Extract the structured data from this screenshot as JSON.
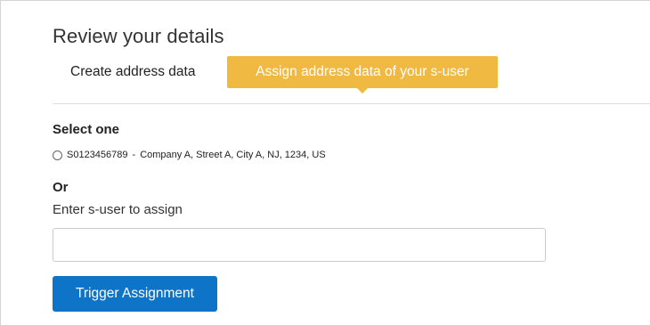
{
  "page": {
    "title": "Review your details"
  },
  "tabs": [
    {
      "label": "Create address data",
      "active": false
    },
    {
      "label": "Assign address data of your s-user",
      "active": true
    }
  ],
  "select_section": {
    "heading": "Select one",
    "options": [
      {
        "id": "S0123456789",
        "separator": "-",
        "address": "Company A, Street A, City A, NJ, 1234, US",
        "selected": false
      }
    ]
  },
  "or_section": {
    "heading": "Or",
    "input_label": "Enter s-user to assign",
    "input_value": "",
    "input_placeholder": ""
  },
  "actions": {
    "submit_label": "Trigger Assignment"
  },
  "colors": {
    "active_tab": "#efb942",
    "primary_button": "#0e74c7",
    "divider": "#dedede"
  }
}
